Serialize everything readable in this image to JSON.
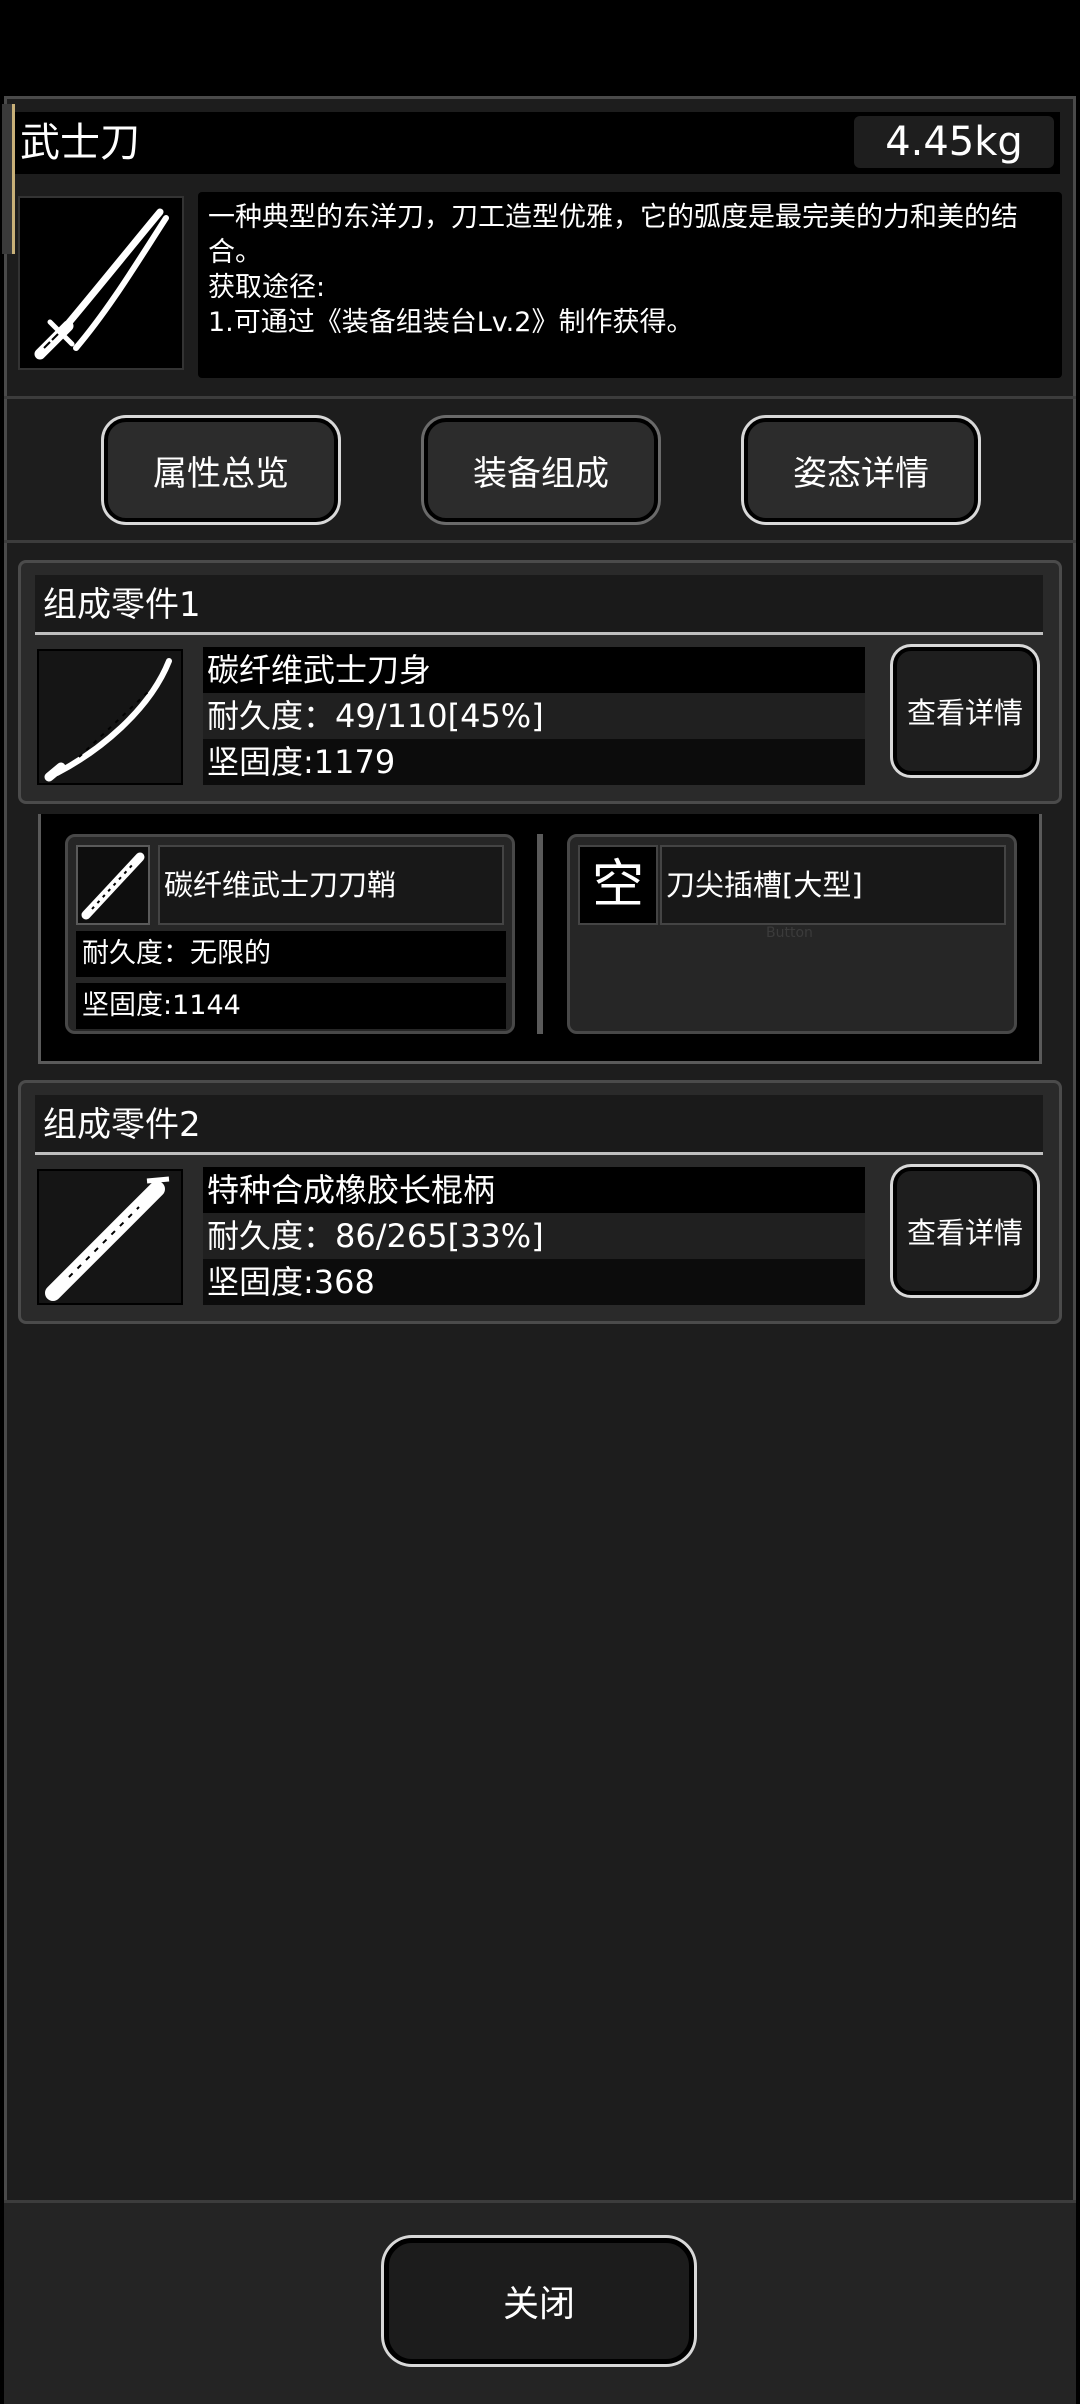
{
  "item": {
    "name": "武士刀",
    "weight": "4.45kg",
    "icon": "katana-icon",
    "description_lines": [
      "一种典型的东洋刀，刀工造型优雅，它的弧度是最完美的力和美的结合。",
      "获取途径:",
      "1.可通过《装备组装台Lv.2》制作获得。"
    ]
  },
  "tabs": [
    {
      "label": "属性总览",
      "active": false
    },
    {
      "label": "装备组成",
      "active": true
    },
    {
      "label": "姿态详情",
      "active": false
    }
  ],
  "parts": [
    {
      "header": "组成零件1",
      "icon": "blade-icon",
      "name": "碳纤维武士刀身",
      "durability": "耐久度：49/110[45%]",
      "hardness": "坚固度:1179",
      "detail_label": "查看详情"
    },
    {
      "header": "组成零件2",
      "icon": "handle-icon",
      "name": "特种合成橡胶长棍柄",
      "durability": "耐久度：86/265[33%]",
      "hardness": "坚固度:368",
      "detail_label": "查看详情"
    }
  ],
  "sub_components": [
    {
      "icon": "sheath-icon",
      "name": "碳纤维武士刀刀鞘",
      "durability": "耐久度：无限的",
      "hardness": "坚固度:1144"
    },
    {
      "empty_label": "空",
      "name": "刀尖插槽[大型]",
      "hint": "Button"
    }
  ],
  "footer": {
    "close_label": "关闭"
  },
  "colors": {
    "background": "#000000",
    "panel": "#1d1d1d",
    "card": "#2a2a2a",
    "button_outline": "#d8d8d8",
    "accent": "#c8b078"
  }
}
